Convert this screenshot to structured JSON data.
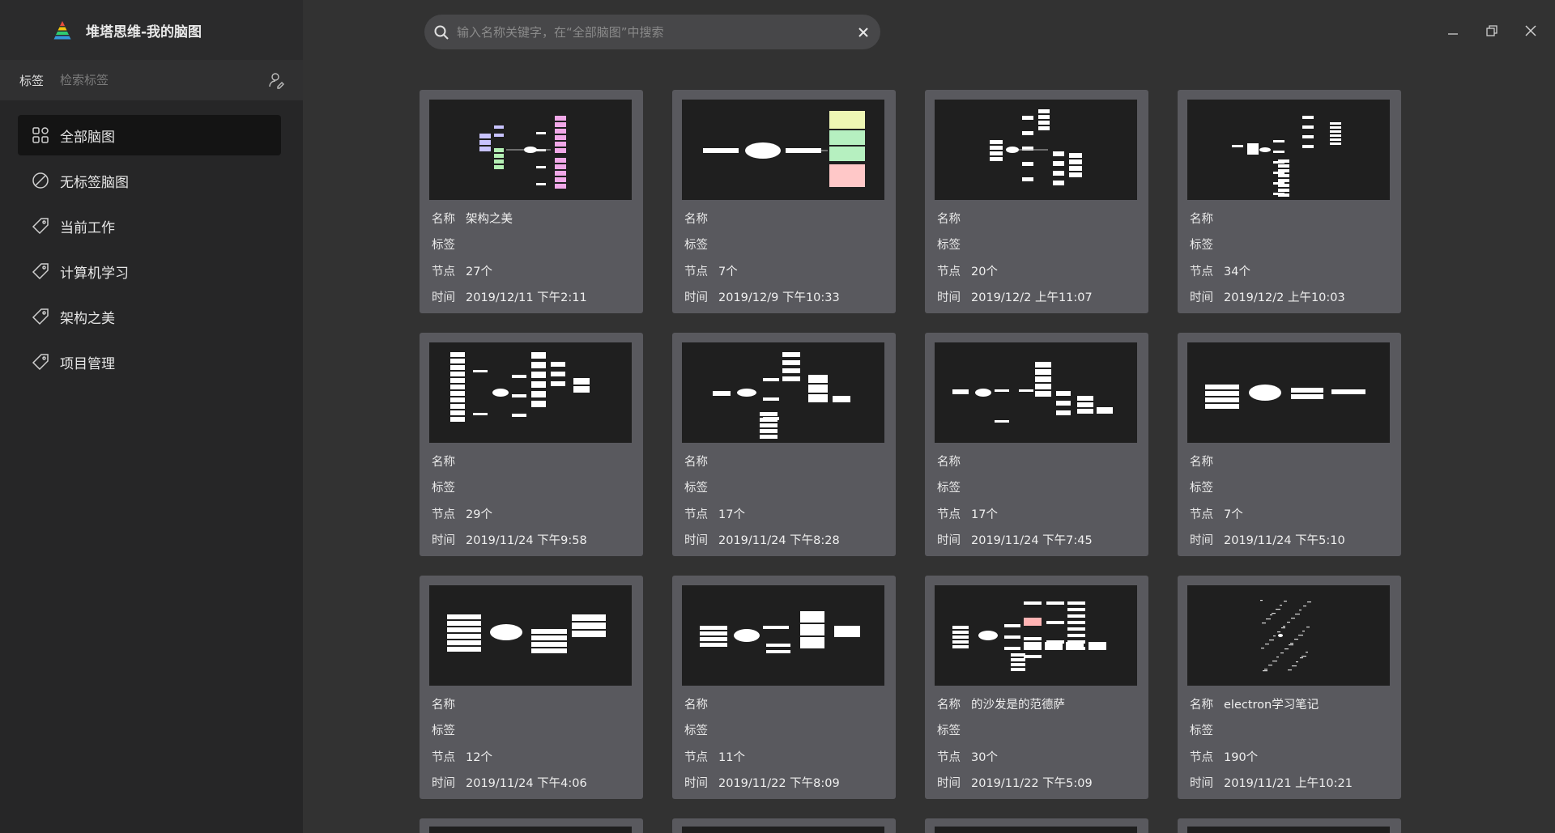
{
  "app": {
    "title": "堆塔思维-我的脑图",
    "logo_icon": "pyramid-logo"
  },
  "sidebar": {
    "tag_label": "标签",
    "tag_search_placeholder": "检索标签",
    "items": [
      {
        "label": "全部脑图",
        "icon": "grid-icon",
        "active": true
      },
      {
        "label": "无标签脑图",
        "icon": "no-tag-icon",
        "active": false
      },
      {
        "label": "当前工作",
        "icon": "tag-icon",
        "active": false
      },
      {
        "label": "计算机学习",
        "icon": "tag-icon",
        "active": false
      },
      {
        "label": "架构之美",
        "icon": "tag-icon",
        "active": false
      },
      {
        "label": "项目管理",
        "icon": "tag-icon",
        "active": false
      }
    ]
  },
  "search": {
    "placeholder": "输入名称关键字，在“全部脑图”中搜索"
  },
  "labels": {
    "name": "名称",
    "tags": "标签",
    "nodes": "节点",
    "time": "时间"
  },
  "cards": [
    {
      "name": "架构之美",
      "tags": "",
      "nodes": "27个",
      "time": "2019/12/11 下午2:11"
    },
    {
      "name": "",
      "tags": "",
      "nodes": "7个",
      "time": "2019/12/9 下午10:33"
    },
    {
      "name": "",
      "tags": "",
      "nodes": "20个",
      "time": "2019/12/2 上午11:07"
    },
    {
      "name": "",
      "tags": "",
      "nodes": "34个",
      "time": "2019/12/2 上午10:03"
    },
    {
      "name": "",
      "tags": "",
      "nodes": "29个",
      "time": "2019/11/24 下午9:58"
    },
    {
      "name": "",
      "tags": "",
      "nodes": "17个",
      "time": "2019/11/24 下午8:28"
    },
    {
      "name": "",
      "tags": "",
      "nodes": "17个",
      "time": "2019/11/24 下午7:45"
    },
    {
      "name": "",
      "tags": "",
      "nodes": "7个",
      "time": "2019/11/24 下午5:10"
    },
    {
      "name": "",
      "tags": "",
      "nodes": "12个",
      "time": "2019/11/24 下午4:06"
    },
    {
      "name": "",
      "tags": "",
      "nodes": "11个",
      "time": "2019/11/22 下午8:09"
    },
    {
      "name": "的沙发是的范德萨",
      "tags": "",
      "nodes": "30个",
      "time": "2019/11/22 下午5:09"
    },
    {
      "name": "electron学习笔记",
      "tags": "",
      "nodes": "190个",
      "time": "2019/11/21 上午10:21"
    }
  ],
  "colors": {
    "sidebar_bg": "#262627",
    "content_bg": "#323232",
    "card_bg": "#59595e",
    "thumb_bg": "#1f1f1f",
    "active_item_bg": "#141414"
  }
}
